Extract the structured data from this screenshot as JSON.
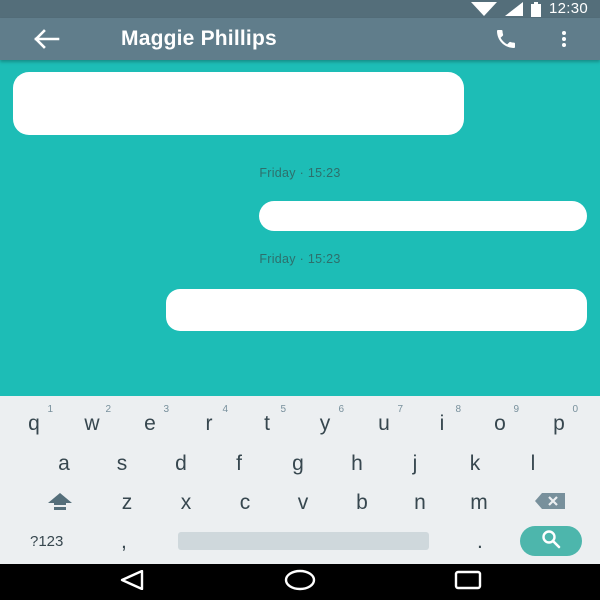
{
  "status_bar": {
    "time": "12:30"
  },
  "app_bar": {
    "contact_name": "Maggie Phillips"
  },
  "chat": {
    "timestamps": [
      "Friday · 15:23",
      "Friday · 15:23"
    ]
  },
  "keyboard": {
    "row1": [
      {
        "key": "q",
        "hint": "1"
      },
      {
        "key": "w",
        "hint": "2"
      },
      {
        "key": "e",
        "hint": "3"
      },
      {
        "key": "r",
        "hint": "4"
      },
      {
        "key": "t",
        "hint": "5"
      },
      {
        "key": "y",
        "hint": "6"
      },
      {
        "key": "u",
        "hint": "7"
      },
      {
        "key": "i",
        "hint": "8"
      },
      {
        "key": "o",
        "hint": "9"
      },
      {
        "key": "p",
        "hint": "0"
      }
    ],
    "row2": [
      "a",
      "s",
      "d",
      "f",
      "g",
      "h",
      "j",
      "k",
      "l"
    ],
    "row3": [
      "z",
      "x",
      "c",
      "v",
      "b",
      "n",
      "m"
    ],
    "symbols_label": "?123",
    "comma": ",",
    "period": "."
  },
  "colors": {
    "chat_background": "#1dbdb6",
    "app_bar": "#607d8b",
    "status_bar": "#546e7a",
    "keyboard": "#eceff1",
    "search_button": "#4db6ac"
  },
  "icons": {
    "back": "arrow-left-icon",
    "call": "phone-icon",
    "more": "more-vert-icon",
    "search": "search-icon",
    "shift": "shift-icon",
    "backspace": "backspace-icon",
    "nav_back": "triangle-back-icon",
    "nav_home": "circle-home-icon",
    "nav_recents": "square-recents-icon"
  }
}
